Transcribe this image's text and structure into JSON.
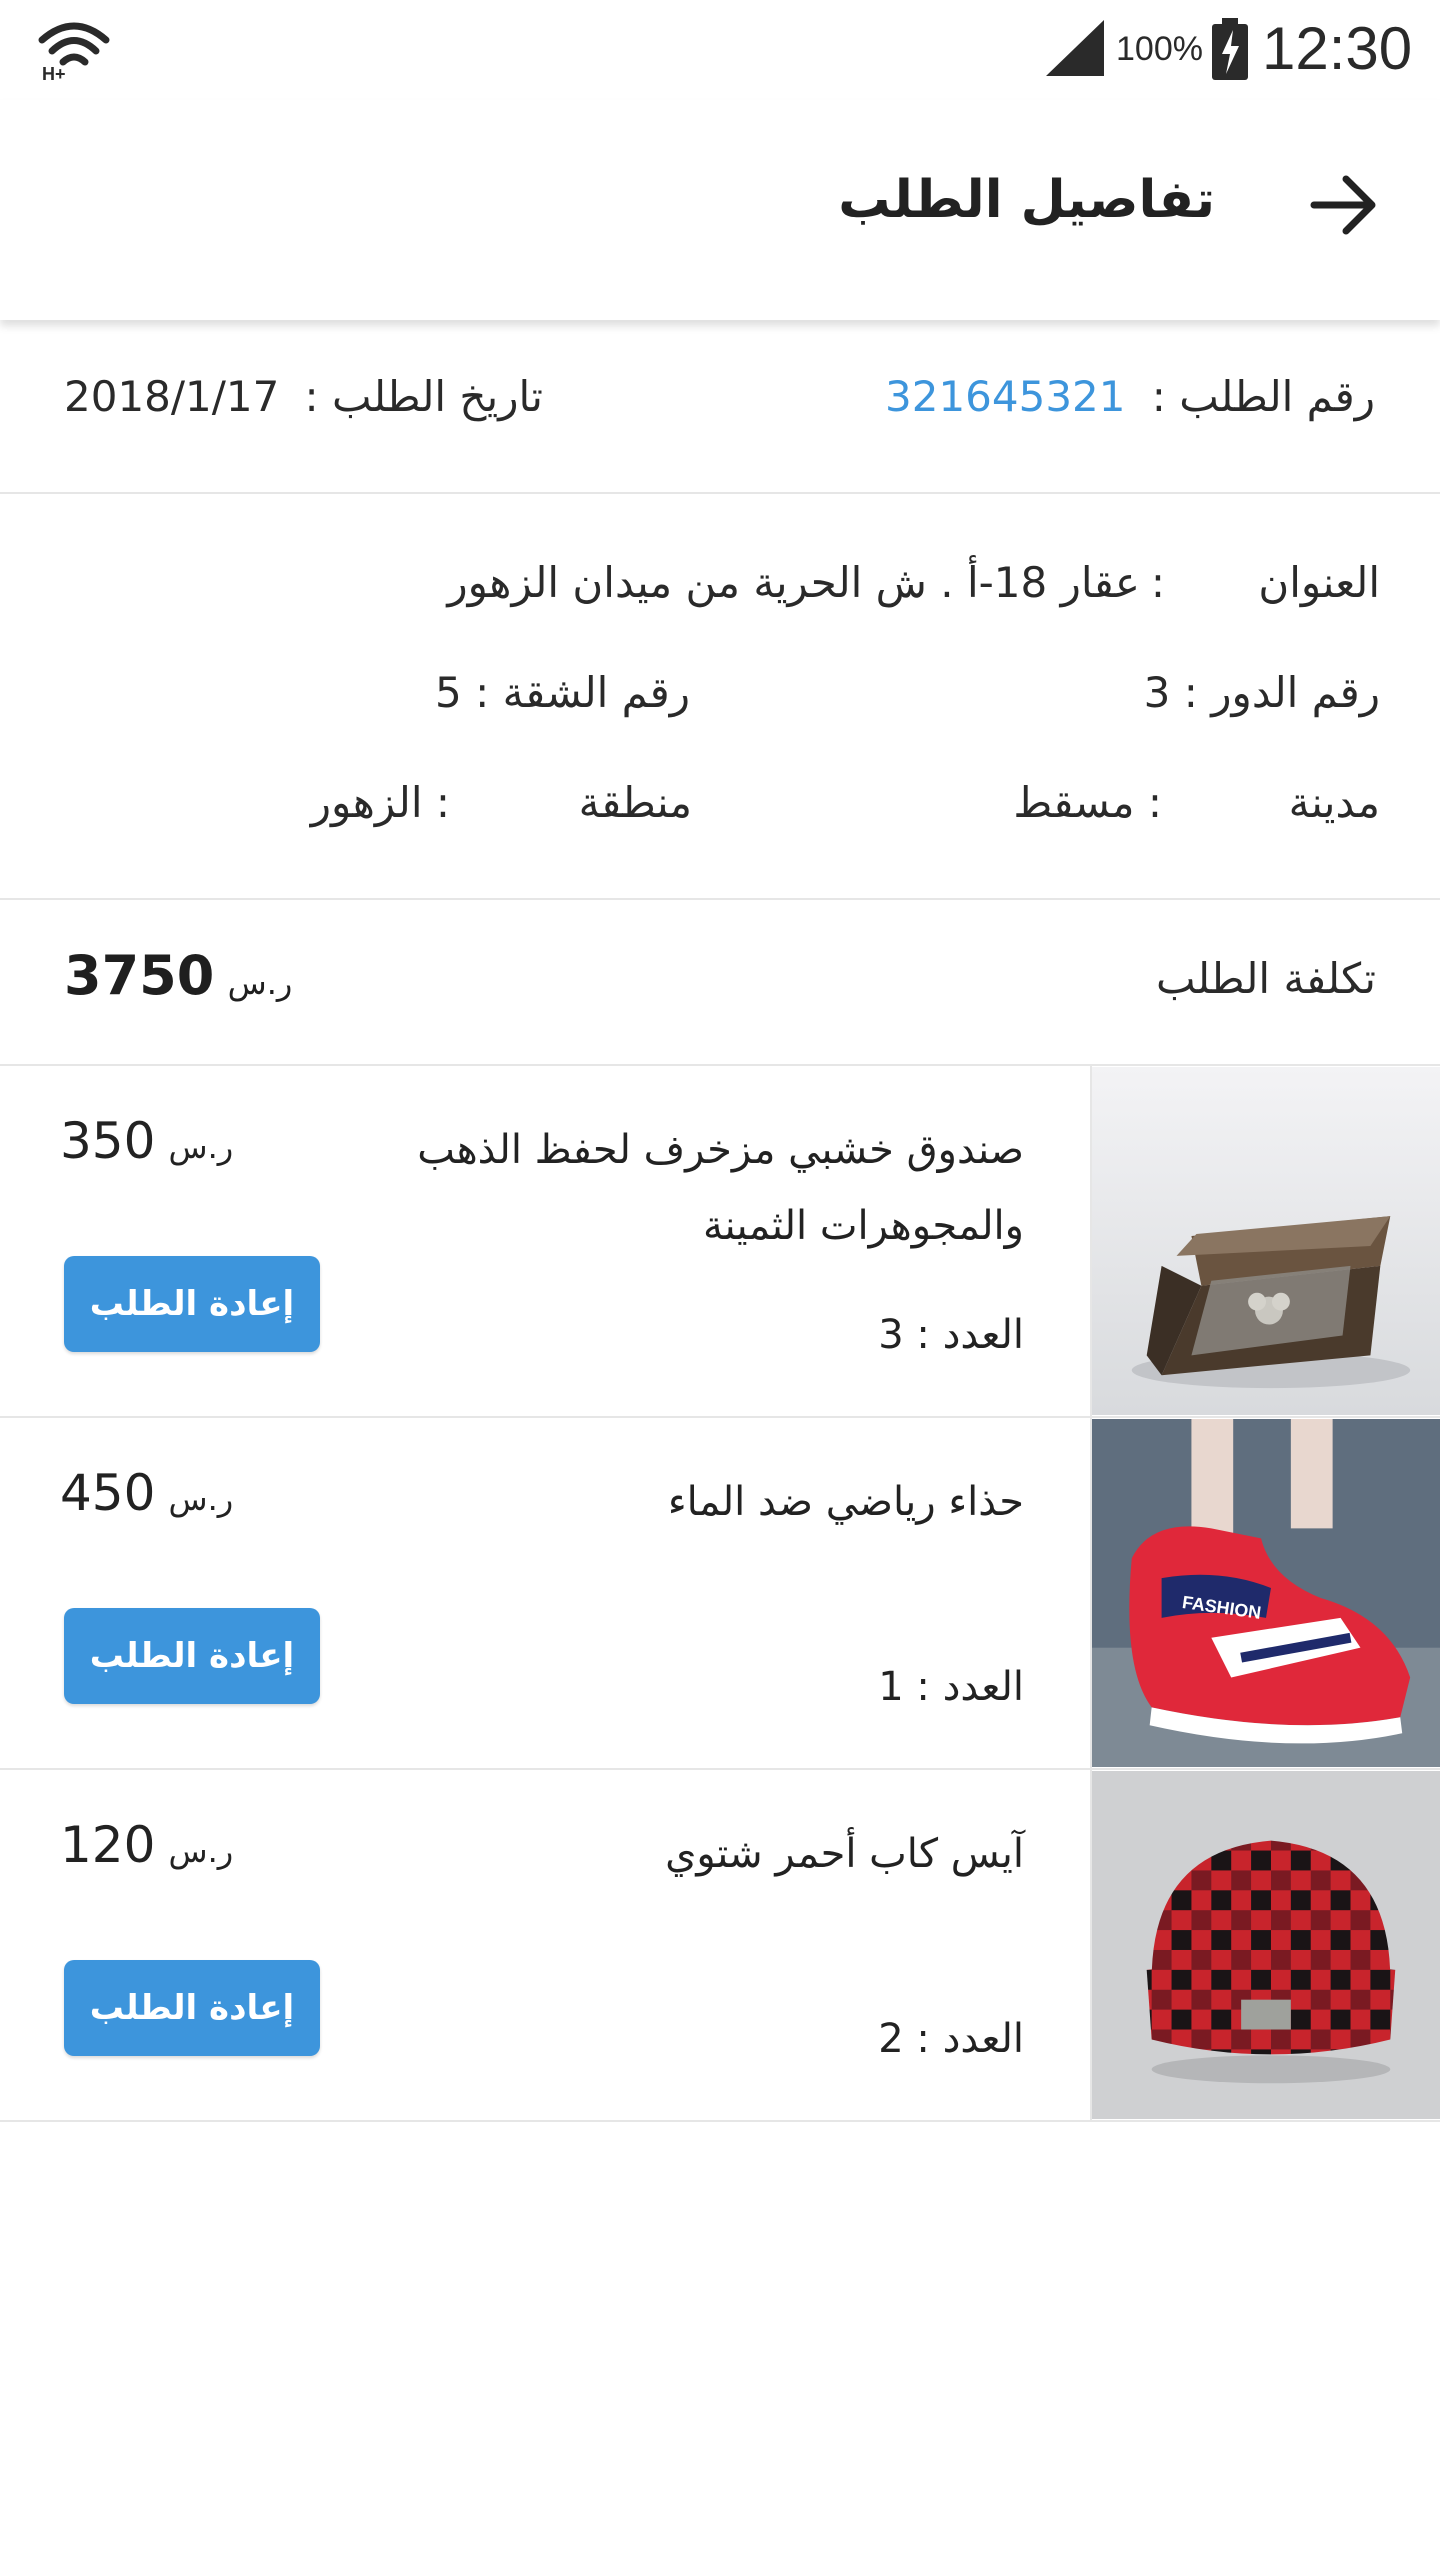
{
  "status_bar": {
    "battery_percent": "100%",
    "time": "12:30"
  },
  "header": {
    "title": "تفاصيل الطلب"
  },
  "order": {
    "number_label": "رقم الطلب :",
    "number_value": "321645321",
    "date_label": "تاريخ الطلب :",
    "date_value": "2018/1/17"
  },
  "address": {
    "address_label": "العنوان",
    "address_colon": ":",
    "address_value": "عقار 18-أ . ش الحرية من ميدان الزهور",
    "floor_label": "رقم الدور : 3",
    "apartment_label": "رقم الشقة : 5",
    "city_label": "مدينة",
    "city_value": ": مسقط",
    "area_label": "منطقة",
    "area_value": ": الزهور"
  },
  "cost": {
    "label": "تكلفة الطلب",
    "amount": "3750",
    "currency": "ر.س"
  },
  "colors": {
    "accent": "#3d95dc",
    "text": "#222222",
    "divider": "#e6e6e6"
  },
  "items": [
    {
      "name": "صندوق خشبي مزخرف لحفظ الذهب والمجوهرات الثمينة",
      "quantity": "العدد : 3",
      "price": "350",
      "currency": "ر.س",
      "button_label": "إعادة الطلب",
      "image_icon": "wooden-box-icon"
    },
    {
      "name": "حذاء رياضي ضد الماء",
      "quantity": "العدد : 1",
      "price": "450",
      "currency": "ر.س",
      "button_label": "إعادة الطلب",
      "image_icon": "sneaker-icon",
      "image_text": "FASHION"
    },
    {
      "name": "آيس كاب أحمر شتوي",
      "quantity": "العدد : 2",
      "price": "120",
      "currency": "ر.س",
      "button_label": "إعادة الطلب",
      "image_icon": "beanie-hat-icon"
    }
  ]
}
